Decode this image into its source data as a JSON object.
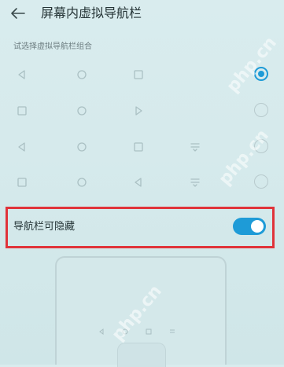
{
  "header": {
    "title": "屏幕内虚拟导航栏"
  },
  "nav_options": {
    "label": "试选择虚拟导航栏组合",
    "rows": [
      {
        "icons": [
          "back-triangle-icon",
          "home-circle-icon",
          "recents-square-icon"
        ],
        "selected": true
      },
      {
        "icons": [
          "recents-square-icon",
          "home-circle-icon",
          "back-triangle-icon-right"
        ],
        "selected": false
      },
      {
        "icons": [
          "back-triangle-icon",
          "home-circle-icon",
          "recents-square-icon",
          "notification-pulldown-icon"
        ],
        "selected": false
      },
      {
        "icons": [
          "recents-square-icon",
          "home-circle-icon",
          "back-triangle-icon-right",
          "notification-pulldown-icon"
        ],
        "selected": false
      }
    ]
  },
  "hide_setting": {
    "label": "导航栏可隐藏",
    "enabled": true
  },
  "watermark": "php.cn",
  "colors": {
    "accent": "#1e9bd7",
    "highlight_border": "#e0333a",
    "background": "#d9ecee"
  }
}
